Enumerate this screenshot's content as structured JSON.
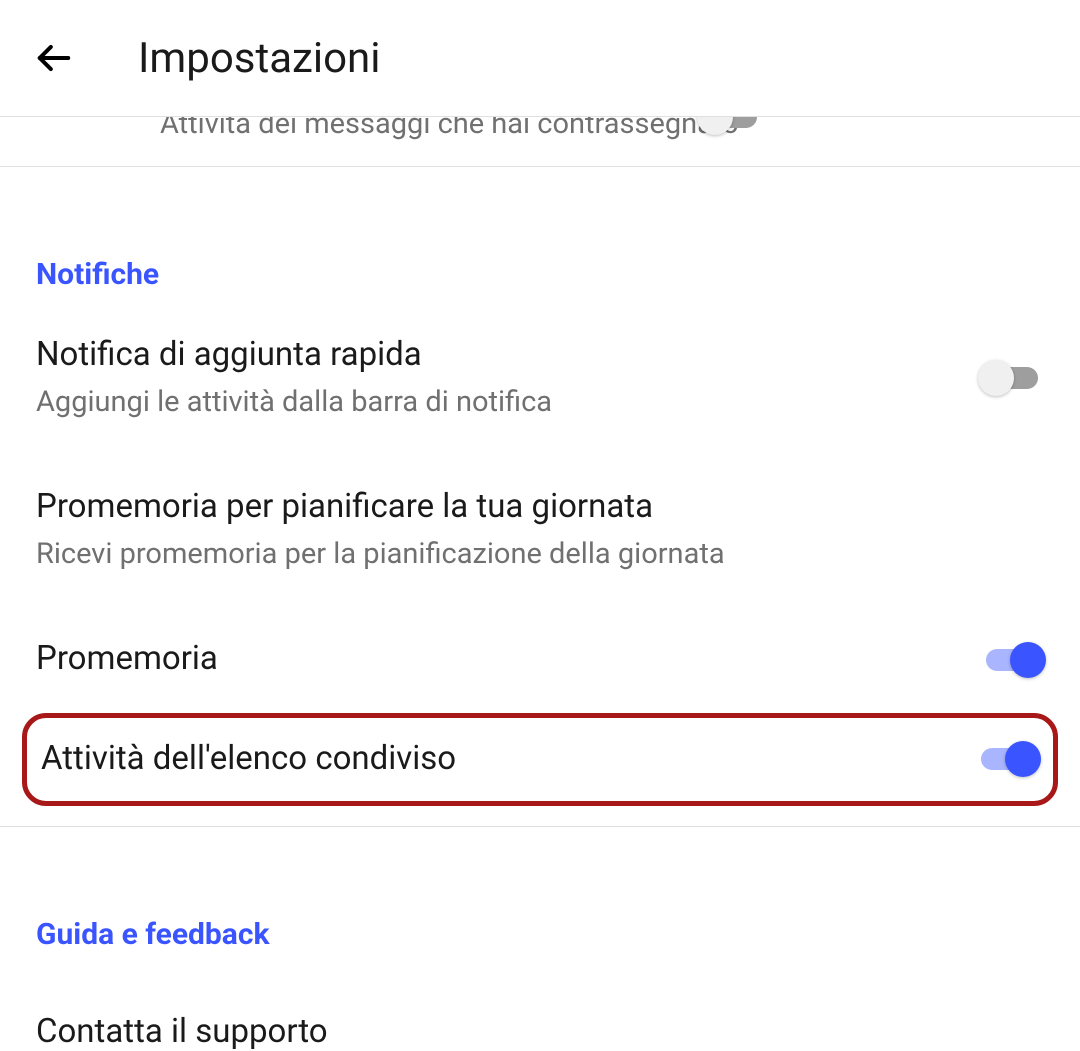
{
  "header": {
    "title": "Impostazioni"
  },
  "truncated": {
    "text": "Attività dei messaggi che hai contrassegnato"
  },
  "notifications": {
    "header": "Notifiche",
    "quick_add": {
      "title": "Notifica di aggiunta rapida",
      "subtitle": "Aggiungi le attività dalla barra di notifica",
      "enabled": false
    },
    "plan_day": {
      "title": "Promemoria per pianificare la tua giornata",
      "subtitle": "Ricevi promemoria per la pianificazione della giornata"
    },
    "reminders": {
      "title": "Promemoria",
      "enabled": true
    },
    "shared_list": {
      "title": "Attività dell'elenco condiviso",
      "enabled": true
    }
  },
  "help": {
    "header": "Guida e feedback",
    "contact": "Contatta il supporto"
  }
}
